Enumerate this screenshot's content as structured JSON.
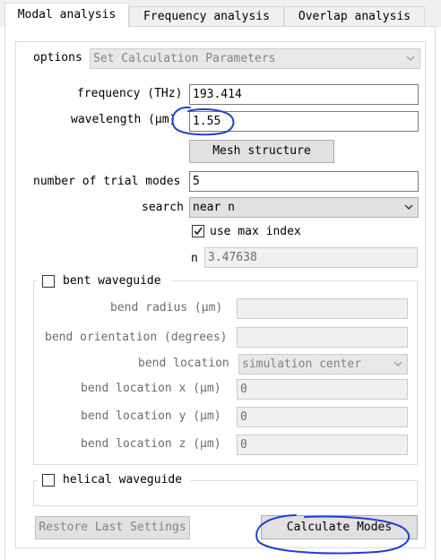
{
  "tabs": [
    {
      "label": "Modal analysis"
    },
    {
      "label": "Frequency analysis"
    },
    {
      "label": "Overlap analysis"
    }
  ],
  "options": {
    "label": "options",
    "value": "Set Calculation Parameters"
  },
  "frequency": {
    "label": "frequency (THz)",
    "value": "193.414"
  },
  "wavelength": {
    "label": "wavelength (μm)",
    "value": "1.55"
  },
  "mesh_button": "Mesh structure",
  "trial_modes": {
    "label": "number of trial modes",
    "value": "5"
  },
  "search": {
    "label": "search",
    "value": "near n"
  },
  "use_max_index": {
    "label": "use max index",
    "checked": true
  },
  "n": {
    "label": "n",
    "value": "3.47638"
  },
  "bent": {
    "label": "bent waveguide",
    "checked": false,
    "radius_label": "bend radius (μm)",
    "orientation_label": "bend orientation (degrees)",
    "location_label": "bend location",
    "location_value": "simulation center",
    "loc_x_label": "bend location x (μm)",
    "loc_x_value": "0",
    "loc_y_label": "bend location y (μm)",
    "loc_y_value": "0",
    "loc_z_label": "bend location z (μm)",
    "loc_z_value": "0"
  },
  "helical": {
    "label": "helical waveguide",
    "checked": false
  },
  "restore_button": "Restore Last Settings",
  "calculate_button": "Calculate Modes",
  "colors": {
    "annotation": "#1f3fd6",
    "check": "#1a1a1a"
  }
}
